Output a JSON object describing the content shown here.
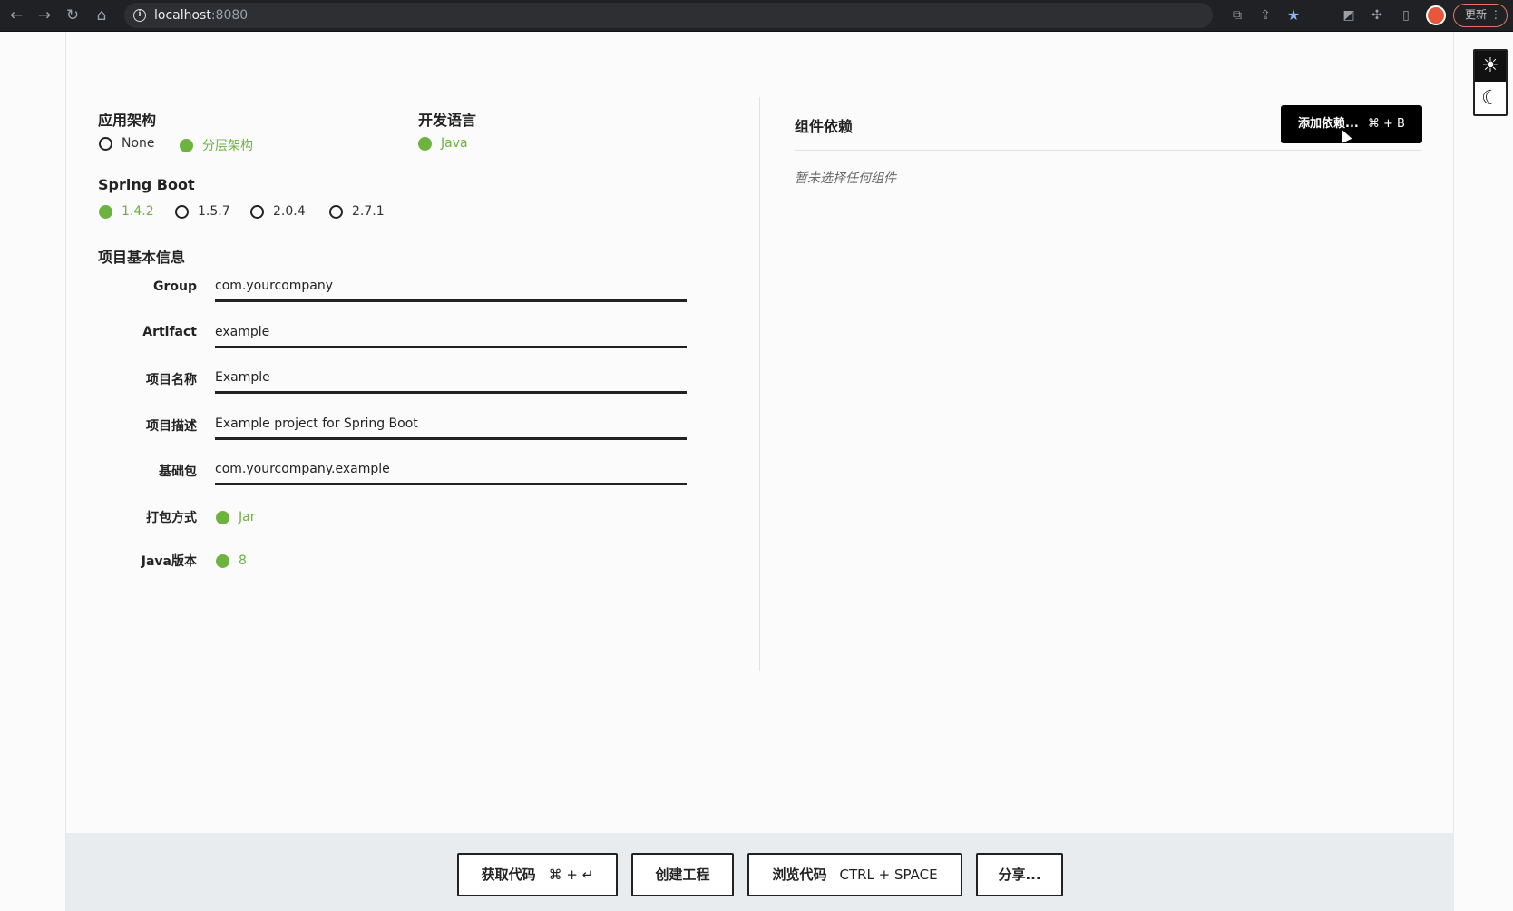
{
  "browser": {
    "url_host": "localhost",
    "url_port": ":8080",
    "update_label": "更新"
  },
  "architecture": {
    "label": "应用架构",
    "options": [
      "None",
      "分层架构"
    ],
    "selected": "分层架构"
  },
  "language": {
    "label": "开发语言",
    "options": [
      "Java"
    ],
    "selected": "Java"
  },
  "spring_boot": {
    "label": "Spring Boot",
    "options": [
      "1.4.2",
      "1.5.7",
      "2.0.4",
      "2.7.1"
    ],
    "selected": "1.4.2"
  },
  "project": {
    "label": "项目基本信息",
    "fields": [
      {
        "label": "Group",
        "value": "com.yourcompany"
      },
      {
        "label": "Artifact",
        "value": "example"
      },
      {
        "label": "项目名称",
        "value": "Example"
      },
      {
        "label": "项目描述",
        "value": "Example project for Spring Boot"
      },
      {
        "label": "基础包",
        "value": "com.yourcompany.example"
      }
    ],
    "packaging": {
      "label": "打包方式",
      "selected": "Jar"
    },
    "java_version": {
      "label": "Java版本",
      "selected": "8"
    }
  },
  "dependencies": {
    "title": "组件依赖",
    "add_label": "添加依赖...",
    "add_shortcut": "⌘ + B",
    "empty_text": "暂未选择任何组件"
  },
  "footer": {
    "get_code_label": "获取代码",
    "get_code_shortcut": "⌘ + ↵",
    "create_label": "创建工程",
    "browse_label": "浏览代码",
    "browse_shortcut": "CTRL + SPACE",
    "share_label": "分享..."
  },
  "colors": {
    "accent": "#6db33f",
    "primary_button": "#000000",
    "footer_bg": "#e8ecee"
  }
}
